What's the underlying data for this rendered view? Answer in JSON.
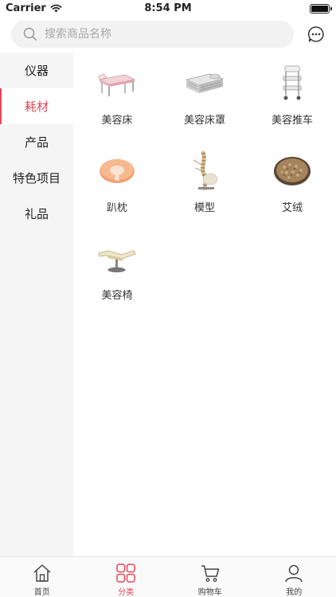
{
  "status_bar": {
    "carrier": "Carrier",
    "time": "8:54 PM"
  },
  "search": {
    "placeholder": "搜索商品名称"
  },
  "categories": [
    {
      "label": "仪器"
    },
    {
      "label": "耗材"
    },
    {
      "label": "产品"
    },
    {
      "label": "特色项目"
    },
    {
      "label": "礼品"
    }
  ],
  "active_category": "耗材",
  "products": [
    {
      "label": "美容床",
      "icon": "beauty-bed-image"
    },
    {
      "label": "美容床罩",
      "icon": "bed-cover-image"
    },
    {
      "label": "美容推车",
      "icon": "beauty-cart-image"
    },
    {
      "label": "趴枕",
      "icon": "face-pillow-image"
    },
    {
      "label": "模型",
      "icon": "spine-model-image"
    },
    {
      "label": "艾绒",
      "icon": "moxa-wool-image"
    },
    {
      "label": "美容椅",
      "icon": "beauty-chair-image"
    }
  ],
  "tabs": [
    {
      "label": "首页",
      "icon": "home-icon"
    },
    {
      "label": "分类",
      "icon": "category-icon"
    },
    {
      "label": "购物车",
      "icon": "cart-icon"
    },
    {
      "label": "我的",
      "icon": "user-icon"
    }
  ],
  "active_tab": "分类",
  "colors": {
    "accent": "#e34556",
    "sidebar_bg": "#f5f5f5",
    "search_bg": "#f2f2f2"
  }
}
